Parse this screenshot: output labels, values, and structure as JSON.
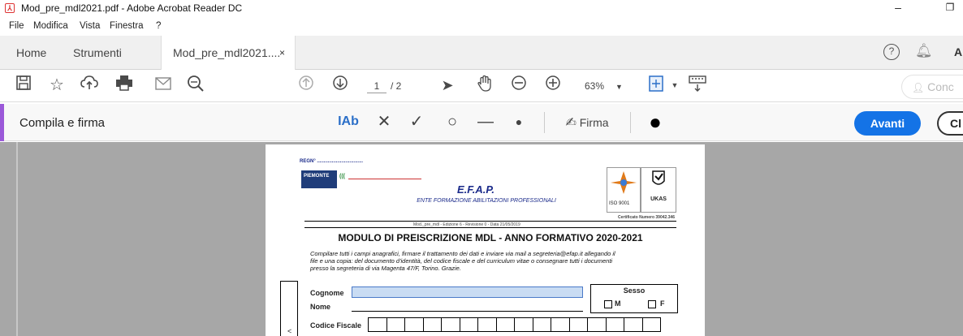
{
  "window": {
    "title": "Mod_pre_mdl2021.pdf - Adobe Acrobat Reader DC"
  },
  "menu": [
    "File",
    "Modifica",
    "Vista",
    "Finestra",
    "?"
  ],
  "tabs": {
    "home": "Home",
    "tools": "Strumenti",
    "doc": "Mod_pre_mdl2021....",
    "close": "×",
    "account": "A"
  },
  "toolbar": {
    "page_current": "1",
    "page_total": "/ 2",
    "zoom": "63%",
    "comment": "Conc"
  },
  "fillsign": {
    "label": "Compila e firma",
    "text_tool": "IAb",
    "sign": "Firma",
    "next": "Avanti",
    "close": "Cl"
  },
  "document": {
    "regn": "REGN° ..................................",
    "efap_title": "E.F.A.P.",
    "efap_subtitle": "ENTE FORMAZIONE ABILITAZIONI PROFESSIONALI",
    "revision": "Mod._pre_mdl - Edizione 6 - Revisione 0 - Data 21/05/2019",
    "cert": "Certificato Numero 39042.346",
    "heading": "MODULO DI PREISCRIZIONE MDL - ANNO FORMATIVO 2020-2021",
    "instr1": "Compilare tutti i campi anagrafici, firmare il trattamento dei dati e inviare via mail a segreteria@efap.it allegando il",
    "instr2": "file e una copia: del documento d'identità,  del codice fiscale e del curriculum vitae o consegnare tutti i documenti",
    "instr3": "presso la segreteria di via Magenta 47/F, Torino. Grazie.",
    "cognome": "Cognome",
    "nome": "Nome",
    "codice_fiscale": "Codice Fiscale",
    "sesso": "Sesso",
    "m": "M",
    "f": "F"
  },
  "colors": {
    "accent": "#9b59d9",
    "primary_button": "#1473e6",
    "doc_bg": "#a7a7a7"
  }
}
